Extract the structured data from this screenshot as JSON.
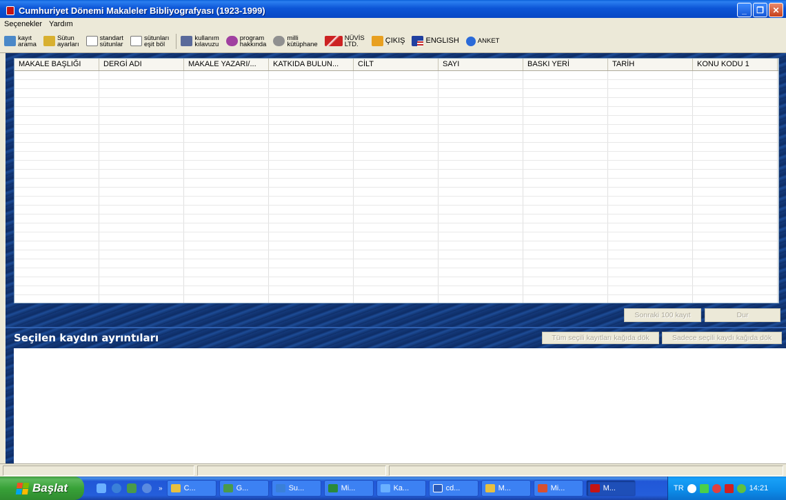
{
  "window": {
    "title": "Cumhuriyet Dönemi Makaleler Bibliyografyası (1923-1999)"
  },
  "menu": [
    "Seçenekler",
    "Yardım"
  ],
  "toolbar": [
    {
      "label": "kayıt\narama",
      "icon": "search-records-icon",
      "color": "#4a88c8"
    },
    {
      "label": "Sütun\nayarları",
      "icon": "column-settings-icon",
      "color": "#d8b030"
    },
    {
      "label": "standart\nsütunlar",
      "icon": "standard-columns-icon",
      "color": "#ffffff"
    },
    {
      "label": "sütunları\neşit böl",
      "icon": "equal-columns-icon",
      "color": "#ffffff"
    },
    {
      "label": "kullanım\nkılavuzu",
      "icon": "manual-icon",
      "color": "#5a6a9a"
    },
    {
      "label": "program\nhakkında",
      "icon": "about-icon",
      "color": "#a040a0"
    },
    {
      "label": "milli\nkütüphane",
      "icon": "library-icon",
      "color": "#909090"
    },
    {
      "label": "NÜVİS\nLTD.",
      "icon": "nuvis-logo-icon",
      "color": "#cc2222"
    },
    {
      "label": "ÇIKIŞ",
      "icon": "exit-icon",
      "color": "#e8a020"
    },
    {
      "label": "ENGLISH",
      "icon": "english-flag-icon",
      "color": "#2040a0"
    },
    {
      "label": "ANKET",
      "icon": "survey-icon",
      "color": "#2a6ad8"
    }
  ],
  "table": {
    "columns": [
      "MAKALE BAŞLIĞI",
      "DERGİ ADI",
      "MAKALE YAZARI/...",
      "KATKIDA BULUN...",
      "CİLT",
      "SAYI",
      "BASKI YERİ",
      "TARİH",
      "KONU KODU 1"
    ]
  },
  "buttons": {
    "next": "Sonraki 100 kayıt",
    "stop": "Dur",
    "print_all": "Tüm seçili kayıtları kağıda dök",
    "print_selected": "Sadece seçili kaydı kağıda dök"
  },
  "details": {
    "title": "Seçilen kaydın ayrıntıları"
  },
  "taskbar": {
    "start": "Başlat",
    "tasks": [
      {
        "label": "C...",
        "icon": "folder-icon",
        "color": "#e8c040"
      },
      {
        "label": "G...",
        "icon": "app-icon",
        "color": "#4a9a4a"
      },
      {
        "label": "Su...",
        "icon": "ie-icon",
        "color": "#3a80d8"
      },
      {
        "label": "Mi...",
        "icon": "excel-icon",
        "color": "#2a8a3a"
      },
      {
        "label": "Ka...",
        "icon": "network-icon",
        "color": "#6ab0ff"
      },
      {
        "label": "cd...",
        "icon": "word-icon",
        "color": "#2a5ab8"
      },
      {
        "label": "M...",
        "icon": "folder-icon",
        "color": "#e8c040"
      },
      {
        "label": "Mi...",
        "icon": "powerpoint-icon",
        "color": "#d85030"
      },
      {
        "label": "M...",
        "icon": "bibliography-app-icon",
        "color": "#c41414",
        "active": true
      }
    ],
    "tray": {
      "lang": "TR",
      "time": "14:21"
    }
  }
}
